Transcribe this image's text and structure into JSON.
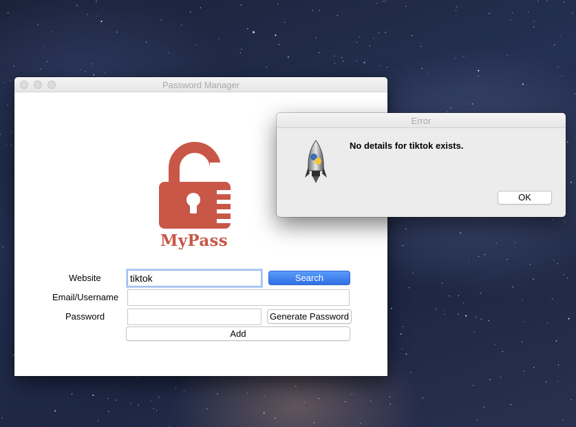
{
  "main_window": {
    "title": "Password Manager",
    "logo_text": "MyPass",
    "form": {
      "website_label": "Website",
      "website_value": "tiktok",
      "search_label": "Search",
      "email_label": "Email/Username",
      "email_value": "",
      "password_label": "Password",
      "password_value": "",
      "generate_label": "Generate Password",
      "add_label": "Add"
    }
  },
  "error_dialog": {
    "title": "Error",
    "message": "No details for tiktok exists.",
    "ok_label": "OK",
    "icon": "python-rocket-icon"
  },
  "colors": {
    "logo_red": "#c85748",
    "primary_button": "#3a7cf0"
  }
}
